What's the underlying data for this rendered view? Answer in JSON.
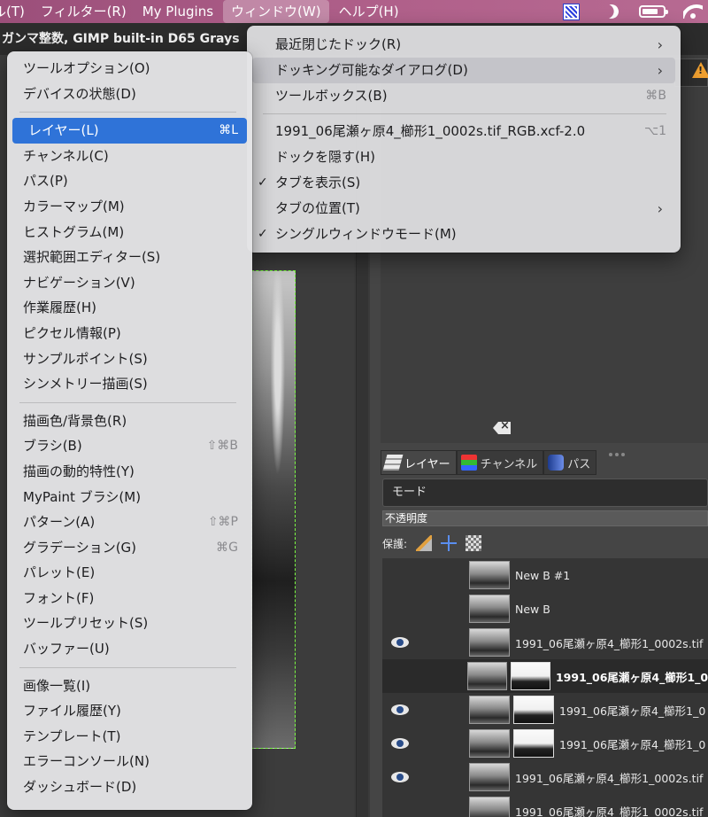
{
  "menubar": {
    "items": [
      "ル(T)",
      "フィルター(R)",
      "My Plugins",
      "ウィンドウ(W)",
      "ヘルプ(H)"
    ],
    "active_index": 3
  },
  "title_strip": "ガンマ整数, GIMP built-in D65 Grays",
  "window_menu": {
    "items": [
      {
        "label": "最近閉じたドック(R)",
        "submenu": true
      },
      {
        "label": "ドッキング可能なダイアログ(D)",
        "submenu": true,
        "hover": true
      },
      {
        "label": "ツールボックス(B)",
        "shortcut": "⌘B"
      },
      {
        "sep": true
      },
      {
        "label": "1991_06尾瀬ヶ原4_櫛形1_0002s.tif_RGB.xcf-2.0",
        "shortcut": "⌥1"
      },
      {
        "label": "ドックを隠す(H)"
      },
      {
        "label": "タブを表示(S)",
        "checked": true
      },
      {
        "label": "タブの位置(T)",
        "submenu": true
      },
      {
        "label": "シングルウィンドウモード(M)",
        "checked": true
      }
    ]
  },
  "docking_submenu": {
    "items": [
      {
        "label": "ツールオプション(O)"
      },
      {
        "label": "デバイスの状態(D)"
      },
      {
        "sep": true
      },
      {
        "label": "レイヤー(L)",
        "shortcut": "⌘L",
        "selected": true
      },
      {
        "label": "チャンネル(C)"
      },
      {
        "label": "パス(P)"
      },
      {
        "label": "カラーマップ(M)"
      },
      {
        "label": "ヒストグラム(M)"
      },
      {
        "label": "選択範囲エディター(S)"
      },
      {
        "label": "ナビゲーション(V)"
      },
      {
        "label": "作業履歴(H)"
      },
      {
        "label": "ピクセル情報(P)"
      },
      {
        "label": "サンプルポイント(S)"
      },
      {
        "label": "シンメトリー描画(S)"
      },
      {
        "sep": true
      },
      {
        "label": "描画色/背景色(R)"
      },
      {
        "label": "ブラシ(B)",
        "shortcut": "⇧⌘B"
      },
      {
        "label": "描画の動的特性(Y)"
      },
      {
        "label": "MyPaint ブラシ(M)"
      },
      {
        "label": "パターン(A)",
        "shortcut": "⇧⌘P"
      },
      {
        "label": "グラデーション(G)",
        "shortcut": "⌘G"
      },
      {
        "label": "パレット(E)"
      },
      {
        "label": "フォント(F)"
      },
      {
        "label": "ツールプリセット(S)"
      },
      {
        "label": "バッファー(U)"
      },
      {
        "sep": true
      },
      {
        "label": "画像一覧(I)"
      },
      {
        "label": "ファイル履歴(Y)"
      },
      {
        "label": "テンプレート(T)"
      },
      {
        "label": "エラーコンソール(N)"
      },
      {
        "label": "ダッシュボード(D)"
      }
    ]
  },
  "dock": {
    "tabs": [
      {
        "label": "レイヤー",
        "icon": "layers-icon",
        "active": true
      },
      {
        "label": "チャンネル",
        "icon": "channels-icon"
      },
      {
        "label": "パス",
        "icon": "paths-icon"
      }
    ],
    "mode_label": "モード",
    "opacity_label": "不透明度",
    "lock_label": "保護:",
    "layers": [
      {
        "name": "New B #1",
        "visible": false,
        "mask": false
      },
      {
        "name": "New B",
        "visible": false,
        "mask": false
      },
      {
        "name": "1991_06尾瀬ヶ原4_櫛形1_0002s.tif",
        "visible": true,
        "mask": false
      },
      {
        "name": "1991_06尾瀬ヶ原4_櫛形1_0",
        "visible": false,
        "mask": true,
        "selected": true
      },
      {
        "name": "1991_06尾瀬ヶ原4_櫛形1_0",
        "visible": true,
        "mask": true
      },
      {
        "name": "1991_06尾瀬ヶ原4_櫛形1_0",
        "visible": true,
        "mask": true
      },
      {
        "name": "1991_06尾瀬ヶ原4_櫛形1_0002s.tif",
        "visible": true,
        "mask": false
      },
      {
        "name": "1991_06尾瀬ヶ原4_櫛形1_0002s.tif",
        "visible": false,
        "mask": false
      }
    ]
  },
  "colors": {
    "menu_selected": "#2f73d8",
    "canvas_guide": "#7cff43",
    "warning": "#f0a030"
  }
}
